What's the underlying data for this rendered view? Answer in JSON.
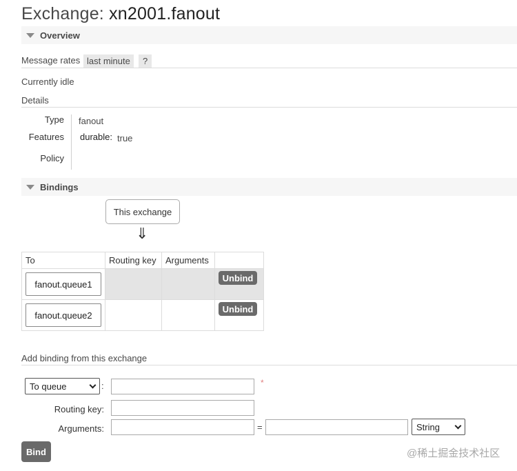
{
  "page": {
    "title_prefix": "Exchange: ",
    "title_name": "xn2001.fanout"
  },
  "overview": {
    "section_label": "Overview",
    "message_rates_label": "Message rates",
    "rate_range": "last minute",
    "help": "?",
    "status": "Currently idle",
    "details_label": "Details"
  },
  "details": {
    "type_label": "Type",
    "type_value": "fanout",
    "features_label": "Features",
    "feature_key": "durable:",
    "feature_value": "true",
    "policy_label": "Policy"
  },
  "bindings": {
    "section_label": "Bindings",
    "source_label": "This exchange",
    "arrow": "⇓",
    "columns": [
      "To",
      "Routing key",
      "Arguments",
      ""
    ],
    "rows": [
      {
        "to": "fanout.queue1",
        "routing_key": "",
        "arguments": "",
        "action": "Unbind"
      },
      {
        "to": "fanout.queue2",
        "routing_key": "",
        "arguments": "",
        "action": "Unbind"
      }
    ]
  },
  "add_binding": {
    "heading": "Add binding from this exchange",
    "destination_type": "To queue",
    "colon": ":",
    "required_mark": "*",
    "routing_key_label": "Routing key:",
    "arguments_label": "Arguments:",
    "equals": "=",
    "arg_type": "String",
    "bind_button": "Bind"
  },
  "watermark": "@稀土掘金技术社区",
  "colors": {
    "button_bg": "#6a6a6a",
    "section_bg": "#f6f6f6",
    "required": "#e08080"
  }
}
